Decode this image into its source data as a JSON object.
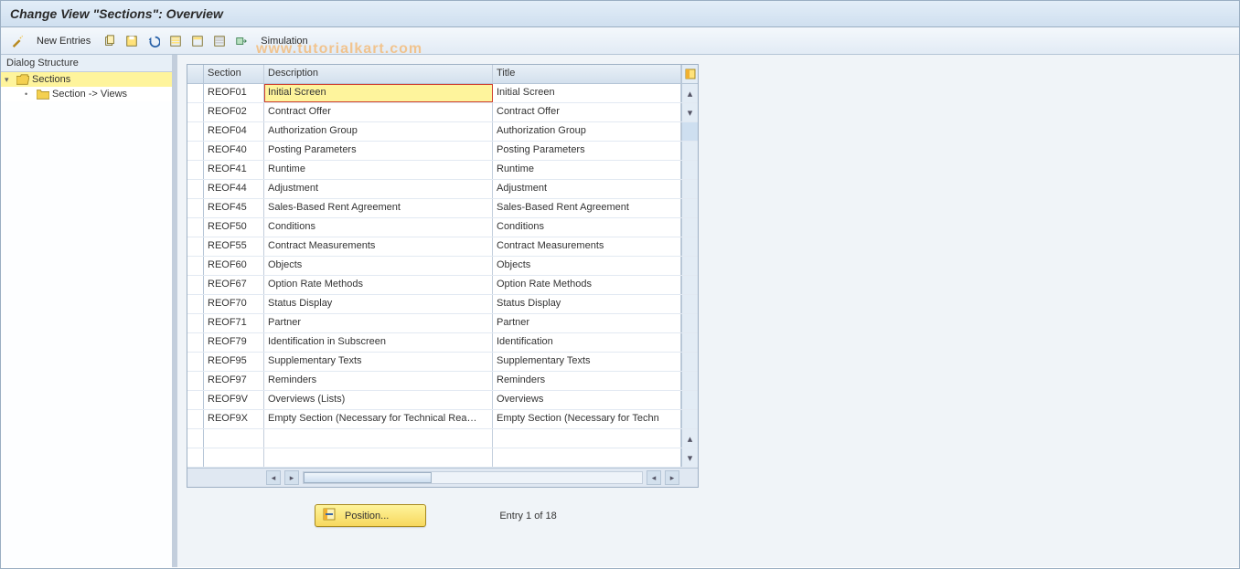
{
  "title": "Change View \"Sections\": Overview",
  "toolbar": {
    "new_entries": "New Entries",
    "simulation": "Simulation",
    "icons": {
      "wand": "wand-icon",
      "copy": "copy-icon",
      "save": "save-icon",
      "undo": "undo-icon",
      "select_all": "select-all-icon",
      "deselect": "deselect-all-icon",
      "delete": "delete-icon",
      "config": "settings-icon"
    }
  },
  "tree": {
    "header": "Dialog Structure",
    "root": "Sections",
    "child": "Section -> Views"
  },
  "table": {
    "columns": {
      "section": "Section",
      "description": "Description",
      "title": "Title"
    },
    "config_tooltip": "Table settings",
    "rows": [
      {
        "section": "REOF01",
        "description": "Initial Screen",
        "title": "Initial Screen",
        "editing": true
      },
      {
        "section": "REOF02",
        "description": "Contract Offer",
        "title": "Contract Offer"
      },
      {
        "section": "REOF04",
        "description": "Authorization Group",
        "title": "Authorization Group"
      },
      {
        "section": "REOF40",
        "description": "Posting Parameters",
        "title": "Posting Parameters"
      },
      {
        "section": "REOF41",
        "description": "Runtime",
        "title": "Runtime"
      },
      {
        "section": "REOF44",
        "description": "Adjustment",
        "title": "Adjustment"
      },
      {
        "section": "REOF45",
        "description": "Sales-Based Rent Agreement",
        "title": "Sales-Based Rent Agreement"
      },
      {
        "section": "REOF50",
        "description": "Conditions",
        "title": "Conditions"
      },
      {
        "section": "REOF55",
        "description": "Contract Measurements",
        "title": "Contract Measurements"
      },
      {
        "section": "REOF60",
        "description": "Objects",
        "title": "Objects"
      },
      {
        "section": "REOF67",
        "description": "Option Rate Methods",
        "title": "Option Rate Methods"
      },
      {
        "section": "REOF70",
        "description": "Status Display",
        "title": "Status Display"
      },
      {
        "section": "REOF71",
        "description": "Partner",
        "title": "Partner"
      },
      {
        "section": "REOF79",
        "description": "Identification in Subscreen",
        "title": "Identification"
      },
      {
        "section": "REOF95",
        "description": "Supplementary Texts",
        "title": "Supplementary Texts"
      },
      {
        "section": "REOF97",
        "description": "Reminders",
        "title": "Reminders"
      },
      {
        "section": "REOF9V",
        "description": "Overviews (Lists)",
        "title": "Overviews"
      },
      {
        "section": "REOF9X",
        "description": "Empty Section (Necessary for Technical Rea…",
        "title": "Empty Section (Necessary for Techn"
      }
    ]
  },
  "footer": {
    "position_label": "Position...",
    "entry_text": "Entry 1 of 18"
  },
  "watermark": "www.tutorialkart.com"
}
